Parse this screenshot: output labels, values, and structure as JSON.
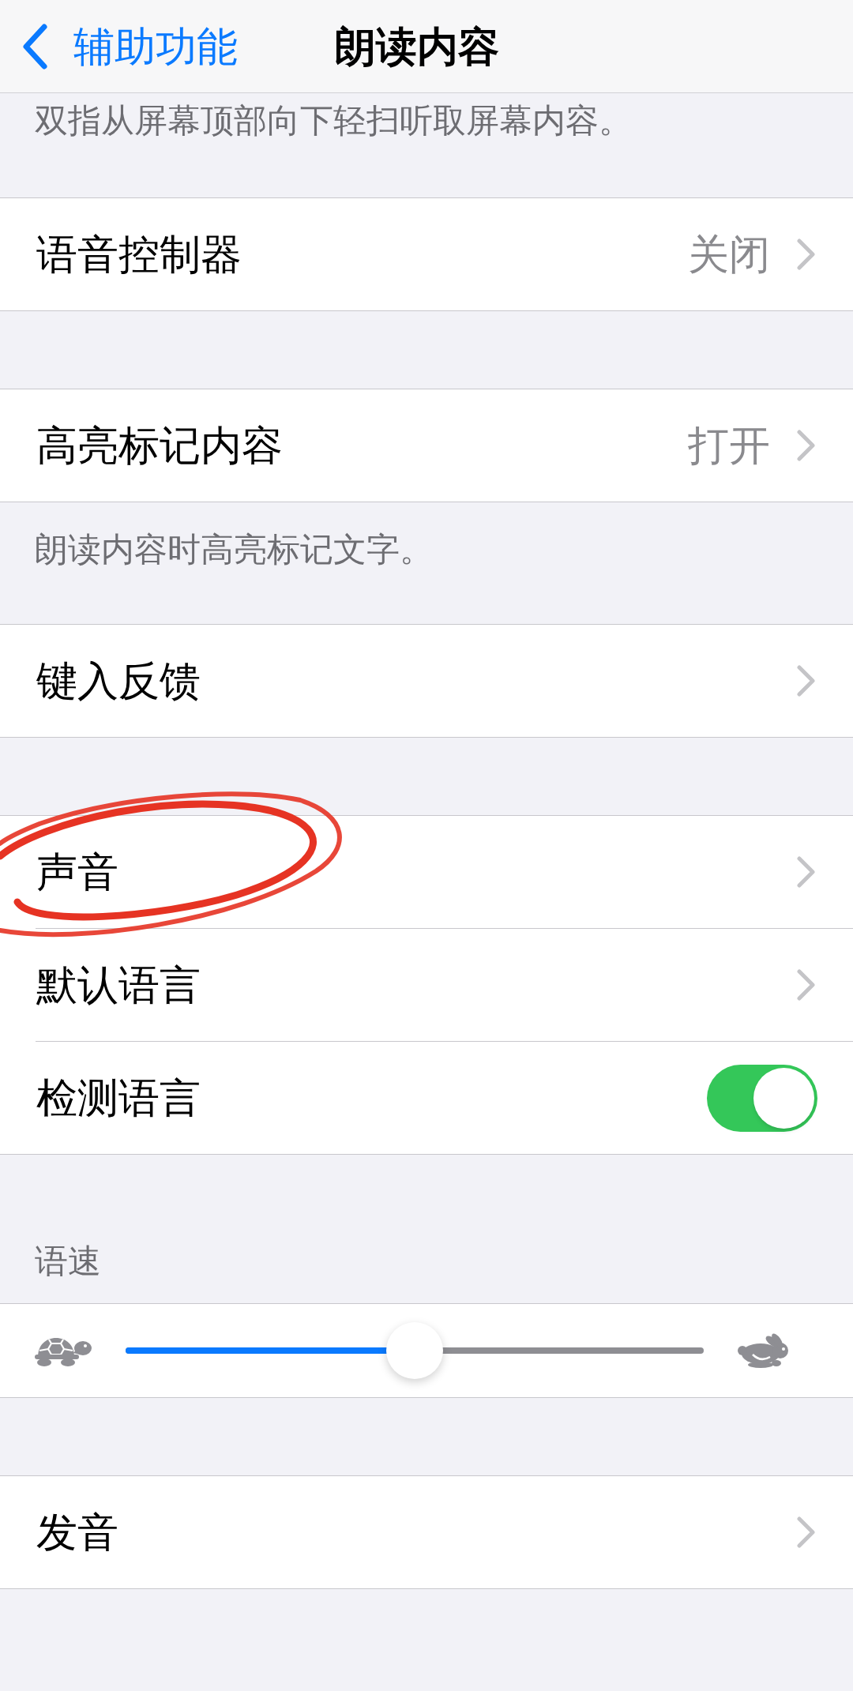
{
  "nav": {
    "back_label": "辅助功能",
    "title": "朗读内容"
  },
  "top_note": "双指从屏幕顶部向下轻扫听取屏幕内容。",
  "sections": [
    {
      "rows": [
        {
          "kind": "link",
          "label": "语音控制器",
          "value": "关闭",
          "circled": false
        }
      ]
    },
    {
      "rows": [
        {
          "kind": "link",
          "label": "高亮标记内容",
          "value": "打开",
          "circled": false
        }
      ],
      "footer": "朗读内容时高亮标记文字。"
    },
    {
      "rows": [
        {
          "kind": "link",
          "label": "键入反馈",
          "circled": false
        }
      ]
    },
    {
      "rows": [
        {
          "kind": "link",
          "label": "声音",
          "circled": true
        },
        {
          "kind": "link",
          "label": "默认语言",
          "circled": false
        },
        {
          "kind": "toggle",
          "label": "检测语言",
          "on": true,
          "circled": false
        }
      ]
    },
    {
      "header": "语速",
      "rows": [
        {
          "kind": "slider",
          "level": 0.5,
          "circled": false
        }
      ]
    },
    {
      "rows": [
        {
          "kind": "link",
          "label": "发音",
          "circled": false
        }
      ]
    }
  ]
}
